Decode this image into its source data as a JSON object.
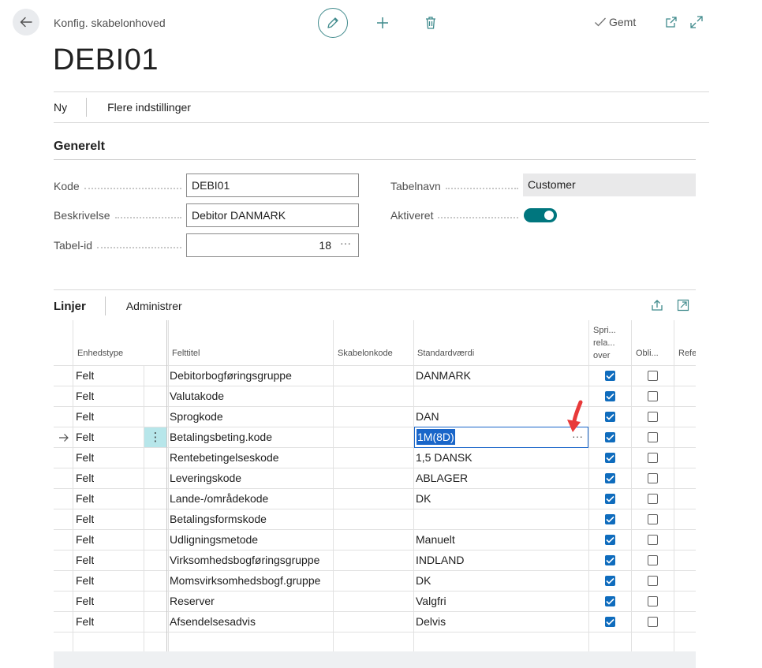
{
  "header": {
    "breadcrumb": "Konfig. skabelonhoved",
    "title": "DEBI01",
    "saved_label": "Gemt"
  },
  "actions": {
    "new_label": "Ny",
    "more_settings_label": "Flere indstillinger"
  },
  "general": {
    "section_title": "Generelt",
    "code_label": "Kode",
    "code_value": "DEBI01",
    "description_label": "Beskrivelse",
    "description_value": "Debitor DANMARK",
    "table_id_label": "Tabel-id",
    "table_id_value": "18",
    "table_id_more": "···",
    "table_name_label": "Tabelnavn",
    "table_name_value": "Customer",
    "enabled_label": "Aktiveret",
    "enabled": true
  },
  "lines": {
    "title": "Linjer",
    "manage_label": "Administrer",
    "columns": {
      "type": "Enhedstype",
      "field_caption": "Felttitel",
      "template_code": "Skabelonkode",
      "default_value": "Standardværdi",
      "skip_relation": [
        "Spri...",
        "rela...",
        "over"
      ],
      "mandatory": "Obli...",
      "reference": "Refe"
    },
    "selected_row_menu": "⋮",
    "edit_more": "···",
    "rows": [
      {
        "type": "Felt",
        "field": "Debitorbogføringsgruppe",
        "template": "",
        "default": "DANMARK",
        "skip": true,
        "mandatory": false
      },
      {
        "type": "Felt",
        "field": "Valutakode",
        "template": "",
        "default": "",
        "skip": true,
        "mandatory": false
      },
      {
        "type": "Felt",
        "field": "Sprogkode",
        "template": "",
        "default": "DAN",
        "skip": true,
        "mandatory": false
      },
      {
        "type": "Felt",
        "field": "Betalingsbeting.kode",
        "template": "",
        "default": "1M(8D)",
        "skip": true,
        "mandatory": false
      },
      {
        "type": "Felt",
        "field": "Rentebetingelseskode",
        "template": "",
        "default": "1,5 DANSK",
        "skip": true,
        "mandatory": false
      },
      {
        "type": "Felt",
        "field": "Leveringskode",
        "template": "",
        "default": "ABLAGER",
        "skip": true,
        "mandatory": false
      },
      {
        "type": "Felt",
        "field": "Lande-/områdekode",
        "template": "",
        "default": "DK",
        "skip": true,
        "mandatory": false
      },
      {
        "type": "Felt",
        "field": "Betalingsformskode",
        "template": "",
        "default": "",
        "skip": true,
        "mandatory": false
      },
      {
        "type": "Felt",
        "field": "Udligningsmetode",
        "template": "",
        "default": "Manuelt",
        "skip": true,
        "mandatory": false
      },
      {
        "type": "Felt",
        "field": "Virksomhedsbogføringsgruppe",
        "template": "",
        "default": "INDLAND",
        "skip": true,
        "mandatory": false
      },
      {
        "type": "Felt",
        "field": "Momsvirksomhedsbogf.gruppe",
        "template": "",
        "default": "DK",
        "skip": true,
        "mandatory": false
      },
      {
        "type": "Felt",
        "field": "Reserver",
        "template": "",
        "default": "Valgfri",
        "skip": true,
        "mandatory": false
      },
      {
        "type": "Felt",
        "field": "Afsendelsesadvis",
        "template": "",
        "default": "Delvis",
        "skip": true,
        "mandatory": false
      }
    ],
    "selected_row_index": 3
  },
  "colors": {
    "accent": "#00767e",
    "checkbox": "#0f6cbd",
    "selection": "#b7e6ea",
    "highlight_text": "#1a66c9",
    "annotation_arrow": "#e83a3a"
  }
}
